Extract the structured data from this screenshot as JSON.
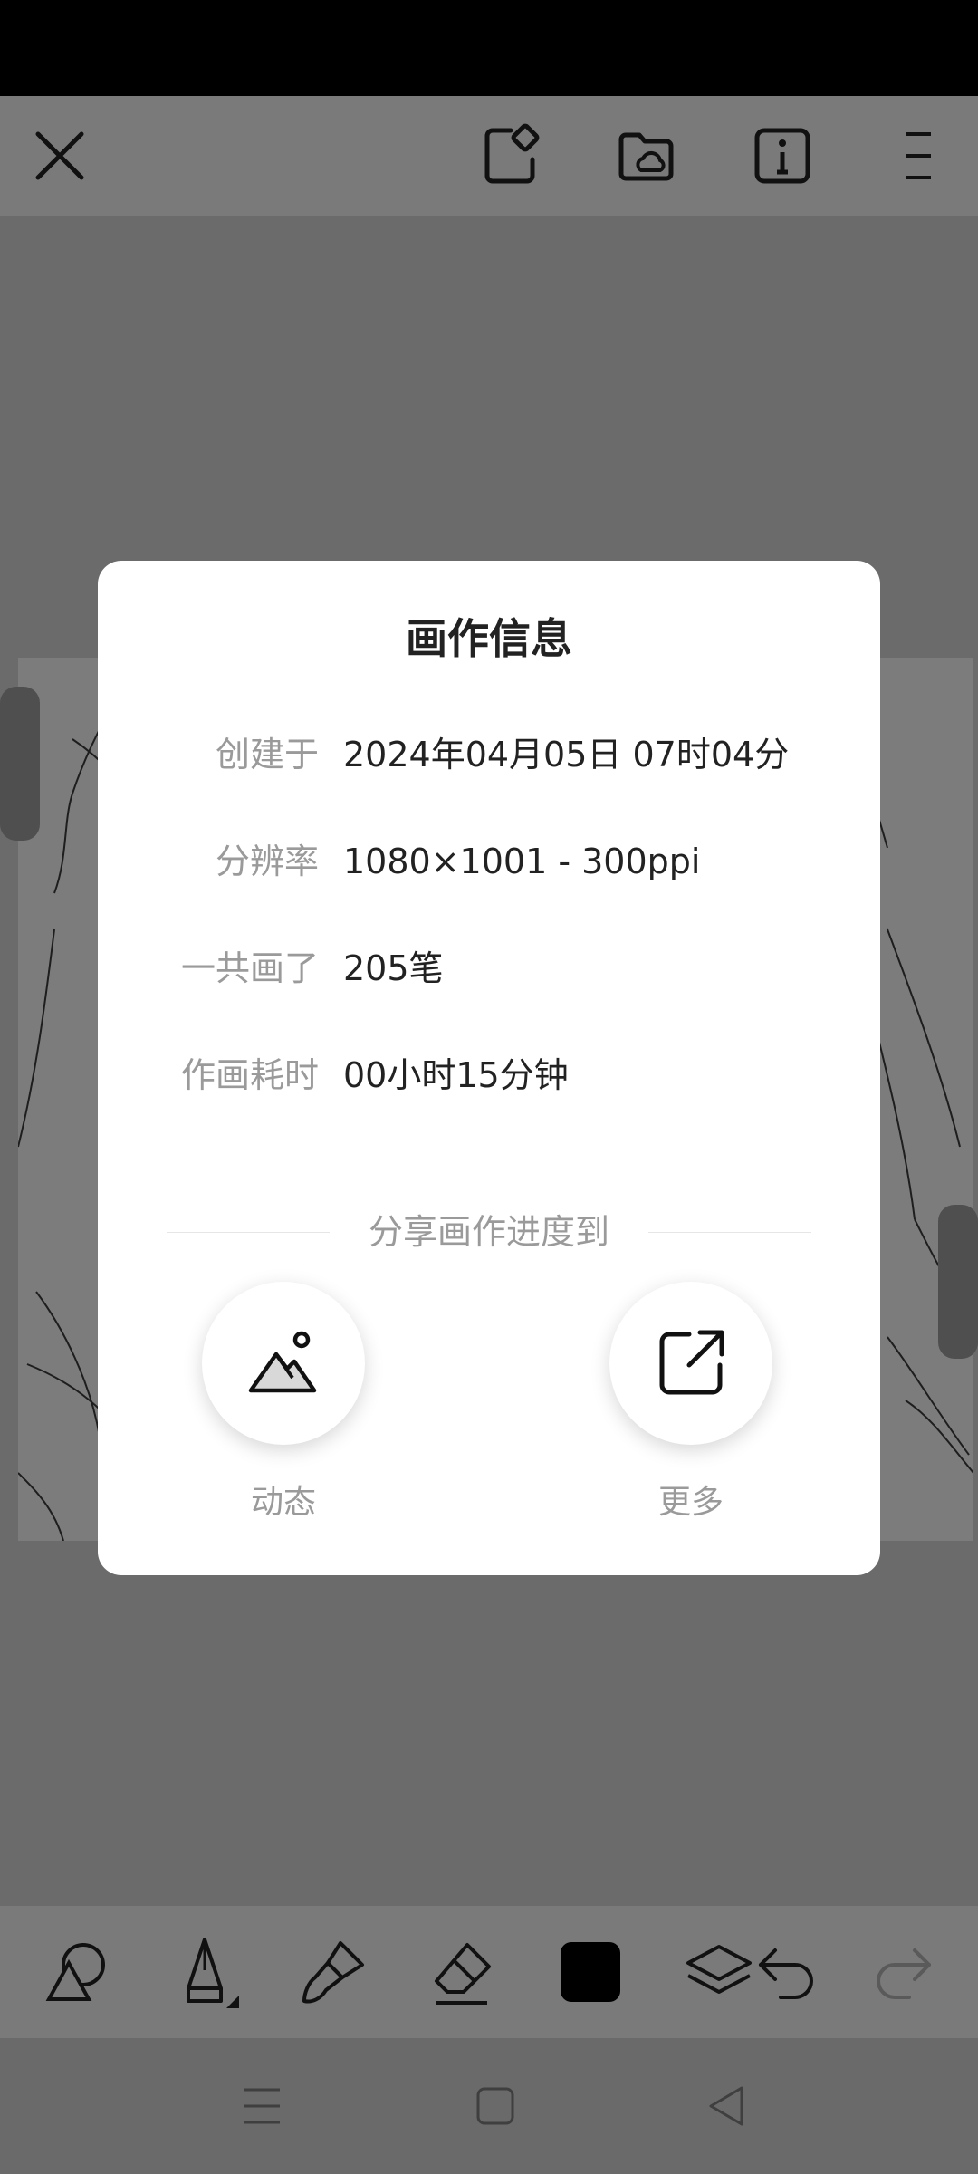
{
  "dialog": {
    "title": "画作信息",
    "rows": [
      {
        "label": "创建于",
        "value": "2024年04月05日 07时04分"
      },
      {
        "label": "分辨率",
        "value": "1080×1001 - 300ppi"
      },
      {
        "label": "一共画了",
        "value": "205笔"
      },
      {
        "label": "作画耗时",
        "value": "00小时15分钟"
      }
    ],
    "share_heading": "分享画作进度到",
    "share_options": [
      {
        "label": "动态",
        "icon": "mountain-image-icon"
      },
      {
        "label": "更多",
        "icon": "external-share-icon"
      }
    ]
  },
  "top_toolbar": {
    "icons": [
      "close-icon",
      "edit-shape-icon",
      "cloud-folder-icon",
      "info-icon",
      "menu-icon"
    ]
  },
  "bottom_toolbar": {
    "icons": [
      "shapes-icon",
      "pen-icon",
      "brush-icon",
      "eraser-icon",
      "color-swatch",
      "layers-icon",
      "undo-icon",
      "redo-icon"
    ],
    "current_color": "#000000"
  },
  "nav_bar": {
    "icons": [
      "recents-icon",
      "home-icon",
      "back-icon"
    ]
  },
  "colors": {
    "dim_background": "#6c6c6c",
    "dialog": "#ffffff",
    "label_gray": "#9a9a9a",
    "text_dark": "#222222"
  }
}
